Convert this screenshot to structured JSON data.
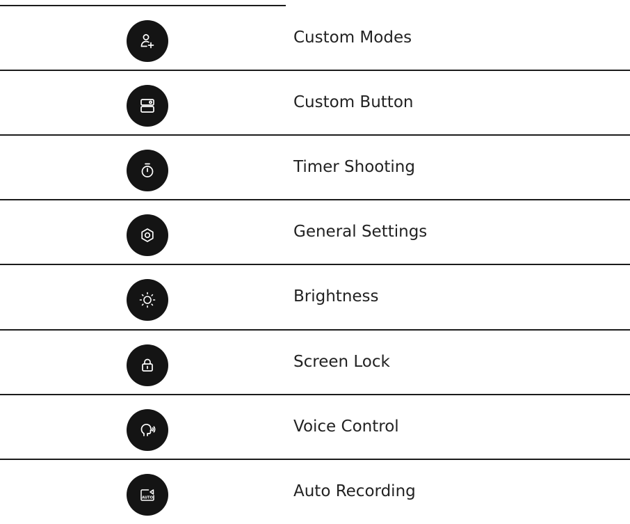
{
  "features": [
    {
      "label": "Custom Modes",
      "icon": "user-add-icon"
    },
    {
      "label": "Custom Button",
      "icon": "custom-button-icon"
    },
    {
      "label": "Timer Shooting",
      "icon": "timer-icon"
    },
    {
      "label": "General Settings",
      "icon": "settings-icon"
    },
    {
      "label": "Brightness",
      "icon": "brightness-icon"
    },
    {
      "label": "Screen Lock",
      "icon": "lock-icon"
    },
    {
      "label": "Voice Control",
      "icon": "voice-control-icon"
    },
    {
      "label": "Auto Recording",
      "icon": "auto-recording-icon"
    }
  ],
  "colors": {
    "icon_background": "#141414",
    "icon_stroke": "#ffffff",
    "rule": "#1b1b1b",
    "text": "#222222"
  }
}
